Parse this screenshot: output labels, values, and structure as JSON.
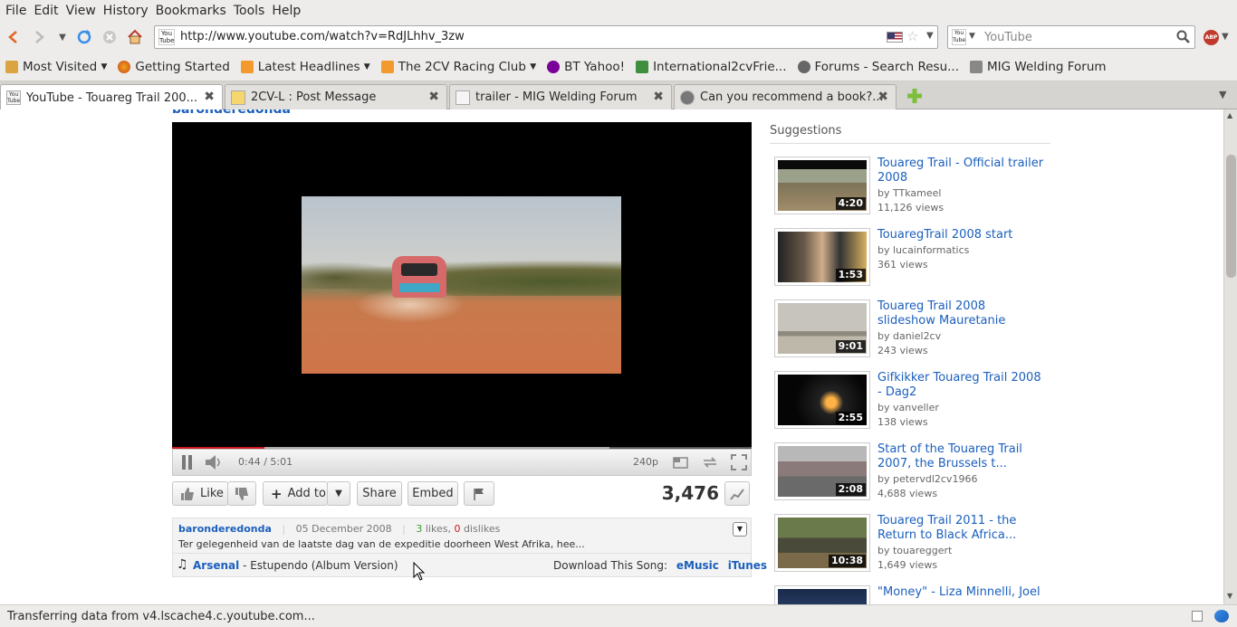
{
  "menu": [
    "File",
    "Edit",
    "View",
    "History",
    "Bookmarks",
    "Tools",
    "Help"
  ],
  "url": "http://www.youtube.com/watch?v=RdJLhhv_3zw",
  "search_engine_placeholder": "YouTube",
  "bookmarks": [
    "Most Visited",
    "Getting Started",
    "Latest Headlines",
    "The 2CV Racing Club",
    "BT Yahoo!",
    "International2cvFrie...",
    "Forums - Search Resu...",
    "MIG Welding Forum"
  ],
  "tabs": [
    "YouTube - Touareg Trail 200...",
    "2CV-L : Post Message",
    "trailer - MIG Welding Forum",
    "Can you recommend a book?..."
  ],
  "player": {
    "time": "0:44 / 5:01",
    "quality": "240p",
    "progress_fraction": 0.159,
    "buffered_fraction": 0.754
  },
  "actions": {
    "like": "Like",
    "add_to": "Add to",
    "share": "Share",
    "embed": "Embed",
    "views": "3,476"
  },
  "info": {
    "uploader": "baronderedonda",
    "date": "05 December 2008",
    "likes": "3",
    "likes_label": "likes,",
    "dislikes": "0",
    "dislikes_label": "dislikes",
    "description": "Ter gelegenheid van de laatste dag van de expeditie doorheen West Afrika, hee...",
    "song_artist": "Arsenal",
    "song_title": "- Estupendo (Album Version)",
    "download_label": "Download This Song:",
    "emusic": "eMusic",
    "itunes": "iTunes"
  },
  "suggestions_title": "Suggestions",
  "suggestions": [
    {
      "title": "Touareg Trail - Official trailer 2008",
      "by": "by TTkameel",
      "views": "11,126 views",
      "duration": "4:20"
    },
    {
      "title": "TouaregTrail 2008 start",
      "by": "by lucainformatics",
      "views": "361 views",
      "duration": "1:53"
    },
    {
      "title": "Touareg Trail 2008 slideshow Mauretanie",
      "by": "by daniel2cv",
      "views": "243 views",
      "duration": "9:01"
    },
    {
      "title": "Gifkikker Touareg Trail 2008 - Dag2",
      "by": "by vanveller",
      "views": "138 views",
      "duration": "2:55"
    },
    {
      "title": "Start of the Touareg Trail 2007, the Brussels t...",
      "by": "by petervdl2cv1966",
      "views": "4,688 views",
      "duration": "2:08"
    },
    {
      "title": "Touareg Trail 2011 - the Return to Black Africa...",
      "by": "by touareggert",
      "views": "1,649 views",
      "duration": "10:38"
    },
    {
      "title": "\"Money\" - Liza Minnelli, Joel",
      "by": "",
      "views": "",
      "duration": ""
    }
  ],
  "top_cut_text": "baronderedonda",
  "status": "Transferring data from v4.lscache4.c.youtube.com..."
}
